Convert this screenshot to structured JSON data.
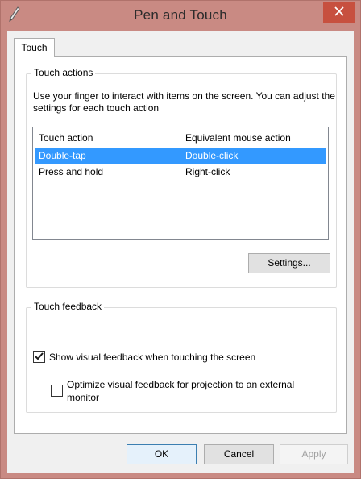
{
  "window": {
    "title": "Pen and Touch",
    "icons": {
      "app": "pen-icon",
      "close": "close-icon"
    }
  },
  "tabs": [
    {
      "label": "Touch",
      "active": true
    }
  ],
  "touch_actions": {
    "group_label": "Touch actions",
    "description": "Use your finger to interact with items on the screen. You can adjust the settings for each touch action",
    "columns": [
      "Touch action",
      "Equivalent mouse action"
    ],
    "rows": [
      {
        "action": "Double-tap",
        "mouse": "Double-click",
        "selected": true
      },
      {
        "action": "Press and hold",
        "mouse": "Right-click",
        "selected": false
      }
    ],
    "settings_button": "Settings..."
  },
  "touch_feedback": {
    "group_label": "Touch feedback",
    "show_visual_feedback": {
      "label": "Show visual feedback when touching the screen",
      "checked": true
    },
    "optimize_projection": {
      "label": "Optimize visual feedback for projection to an external monitor",
      "checked": false
    }
  },
  "buttons": {
    "ok": "OK",
    "cancel": "Cancel",
    "apply": "Apply"
  },
  "colors": {
    "selection": "#3399ff",
    "close_button": "#c7503f",
    "frame": "#c98a83"
  }
}
